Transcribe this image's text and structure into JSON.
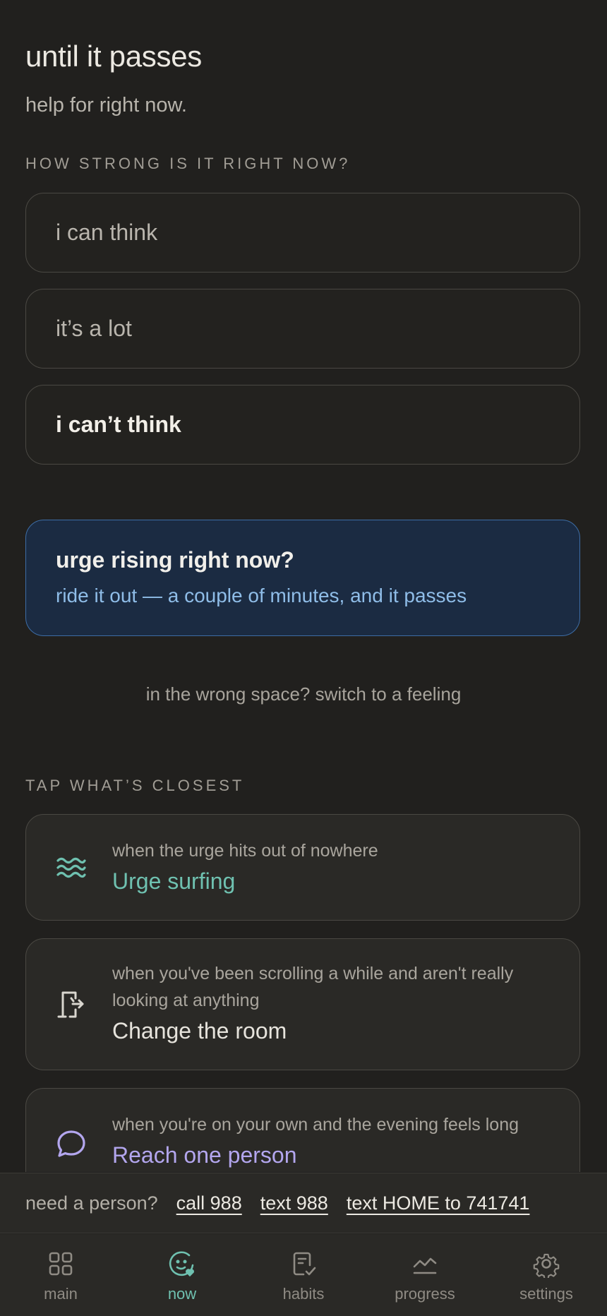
{
  "header": {
    "title": "until it passes",
    "subtitle": "help for right now."
  },
  "strength": {
    "label": "HOW STRONG IS IT RIGHT NOW?",
    "options": [
      "i can think",
      "it’s a lot",
      "i can’t think"
    ]
  },
  "urge_card": {
    "title": "urge rising right now?",
    "subtitle": "ride it out — a couple of minutes, and it passes",
    "accent": "#8fbde8"
  },
  "switch_link": "in the wrong space? switch to a feeling",
  "tools": {
    "label": "TAP WHAT’S CLOSEST",
    "items": [
      {
        "hint": "when the urge hits out of nowhere",
        "name": "Urge surfing",
        "icon": "waves-icon",
        "color": "#6fc1b0"
      },
      {
        "hint": "when you've been scrolling a while and aren't really looking at anything",
        "name": "Change the room",
        "icon": "door-exit-icon",
        "color": "#e6e3dc"
      },
      {
        "hint": "when you're on your own and the evening feels long",
        "name": "Reach one person",
        "icon": "chat-bubble-icon",
        "color": "#b3a6ee"
      }
    ]
  },
  "crisis": {
    "lead": "need a person?",
    "links": [
      "call 988",
      "text 988",
      "text HOME to 741741"
    ]
  },
  "tabs": [
    {
      "label": "main",
      "icon": "grid-icon"
    },
    {
      "label": "now",
      "icon": "face-heart-icon",
      "active": true
    },
    {
      "label": "habits",
      "icon": "checklist-icon"
    },
    {
      "label": "progress",
      "icon": "trend-icon"
    },
    {
      "label": "settings",
      "icon": "gear-icon"
    }
  ]
}
